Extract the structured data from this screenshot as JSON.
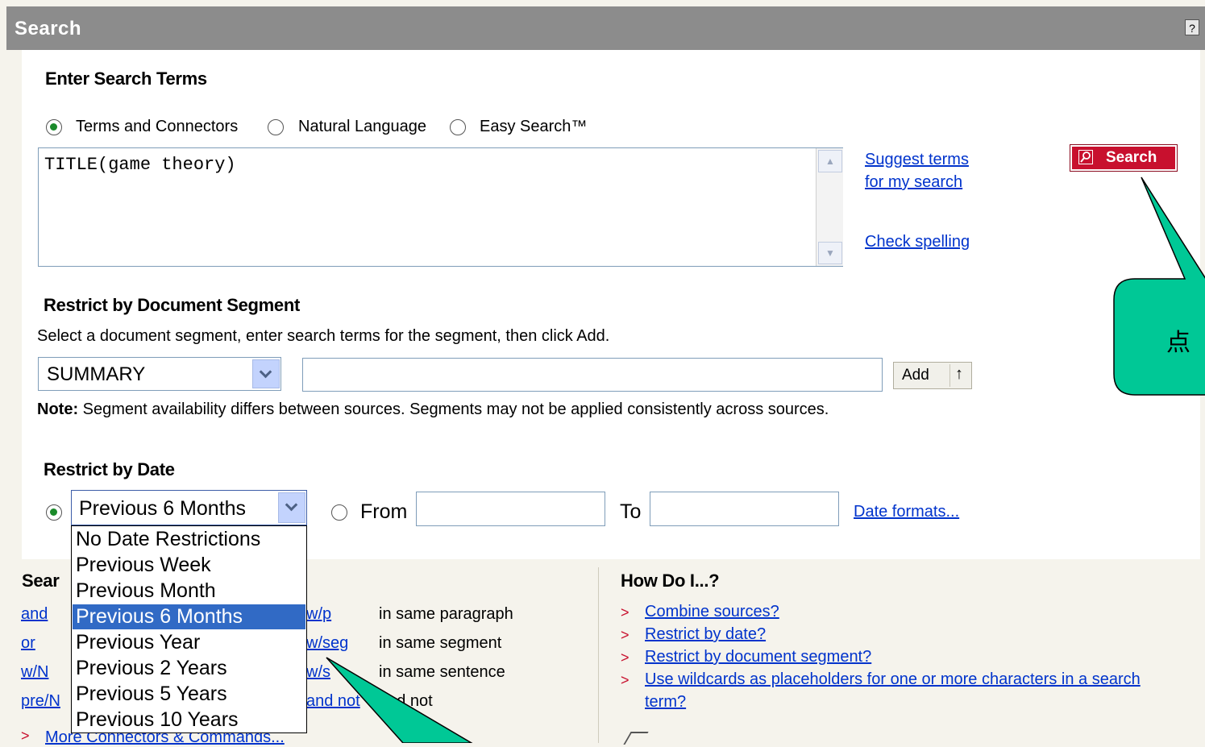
{
  "header": {
    "title": "Search",
    "help_label": "?"
  },
  "enter_terms": {
    "heading": "Enter Search Terms",
    "modes": [
      "Terms and Connectors",
      "Natural Language",
      "Easy Search™"
    ],
    "selected_mode": "Terms and Connectors",
    "query": "TITLE(game theory)",
    "links": {
      "suggest_line1": "Suggest terms",
      "suggest_line2": "for my search",
      "check_spelling": "Check spelling"
    },
    "search_button": "Search"
  },
  "segment": {
    "heading": "Restrict by Document Segment",
    "instruction": "Select a document segment, enter search terms for the segment, then click Add.",
    "selected": "SUMMARY",
    "term_value": "",
    "add_label": "Add",
    "add_icon": "up-arrow-icon",
    "note_bold": "Note:",
    "note_text": " Segment availability differs between sources. Segments may not be applied consistently across sources."
  },
  "date": {
    "heading": "Restrict by Date",
    "selected": "Previous 6 Months",
    "options": [
      "No Date Restrictions",
      "Previous Week",
      "Previous Month",
      "Previous 6 Months",
      "Previous Year",
      "Previous 2 Years",
      "Previous 5 Years",
      "Previous 10 Years"
    ],
    "from_label": "From",
    "to_label": "To",
    "from_value": "",
    "to_value": "",
    "formats_link": "Date formats..."
  },
  "connectors": {
    "heading_visible": "Sear",
    "left": [
      "and",
      "or",
      "w/N",
      "pre/N"
    ],
    "mid": [
      "w/p",
      "w/seg",
      "w/s",
      "and not"
    ],
    "desc": [
      "in same paragraph",
      "in same segment",
      "in same sentence",
      "and not"
    ],
    "more_link": "More Connectors & Commands..."
  },
  "how_do_i": {
    "heading": "How Do I...?",
    "items": [
      "Combine sources?",
      "Restrict by date?",
      "Restrict by document segment?",
      "Use wildcards as placeholders for one or more characters in a search",
      "term?"
    ]
  },
  "callout": {
    "text": "点"
  },
  "colors": {
    "header": "#8c8c8c",
    "search_button": "#c8102e",
    "callout": "#00c896",
    "link": "#0033cc"
  }
}
